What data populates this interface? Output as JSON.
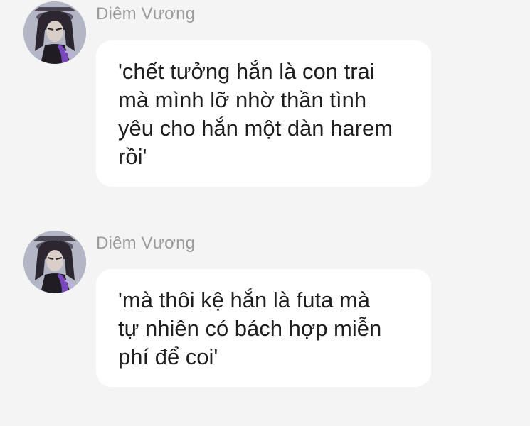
{
  "messages": [
    {
      "sender": "Diêm Vương",
      "text": "'chết tưởng hắn là con trai\nmà mình lỡ nhờ thần tình\nyêu cho hắn một dàn harem\nrồi'"
    },
    {
      "sender": "Diêm Vương",
      "text": "'mà thôi kệ hắn là futa mà\ntự nhiên có bách hợp miễn\nphí để coi'"
    }
  ],
  "colors": {
    "background": "#f4f4f4",
    "bubble": "#ffffff",
    "sender_name": "#9b9b9b",
    "message_text": "#1f1f1f",
    "avatar_accent": "#8a4fd8"
  },
  "icons": {
    "avatar": "user-avatar-anime-portrait"
  }
}
